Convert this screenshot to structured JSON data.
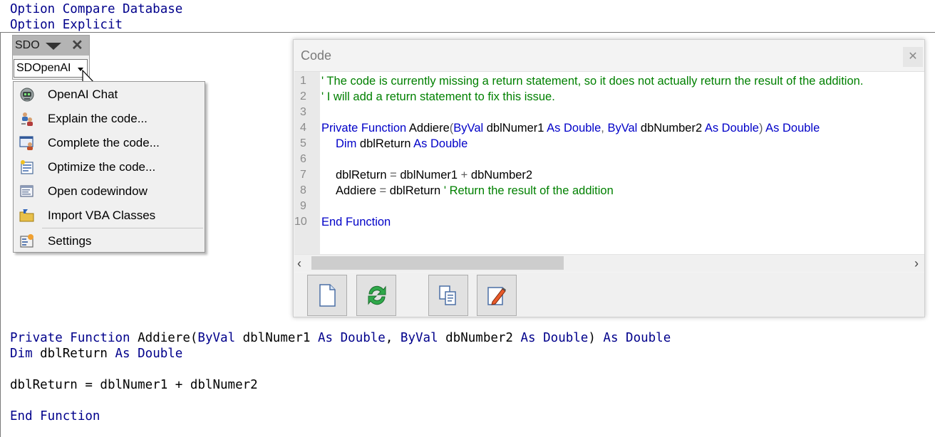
{
  "editor": {
    "header_lines": [
      "Option Compare Database",
      "Option Explicit"
    ],
    "func_keyword_private": "Private Function",
    "func_name": "Addiere(",
    "func_byval1": "ByVal",
    "func_param1": " dblNumer1 ",
    "func_as1": "As Double",
    "func_comma": ", ",
    "func_byval2": "ByVal",
    "func_param2": " dbNumber2 ",
    "func_as2": "As Double",
    "func_close": ") ",
    "func_ret": "As Double",
    "dim_kw": "Dim",
    "dim_var": " dblReturn ",
    "dim_as": "As Double",
    "assign_line": "dblReturn = dblNumer1 + dblNumer2",
    "end_function": "End Function"
  },
  "toolbar": {
    "title": "SDO",
    "close_glyph": "✕",
    "dropdown_label": "SDOpenAI"
  },
  "menu": {
    "items": [
      {
        "label": "OpenAI Chat",
        "icon": "robot-icon"
      },
      {
        "label": "Explain the code...",
        "icon": "users-icon"
      },
      {
        "label": "Complete the code...",
        "icon": "window-user-icon"
      },
      {
        "label": "Optimize the code...",
        "icon": "optimize-icon"
      },
      {
        "label": "Open codewindow",
        "icon": "codewindow-icon"
      },
      {
        "label": "Import VBA Classes",
        "icon": "folder-import-icon"
      },
      {
        "label": "Settings",
        "icon": "settings-icon"
      }
    ]
  },
  "codewin": {
    "title": "Code",
    "close_glyph": "✕",
    "line_numbers": [
      "1",
      "2",
      "3",
      "4",
      "5",
      "6",
      "7",
      "8",
      "9",
      "10"
    ],
    "line1": "' The code is currently missing a return statement, so it does not actually return the result of the addition.",
    "line2": "' I will add a return statement to fix this issue.",
    "l4_private": "Private Function",
    "l4_name": " Addiere",
    "l4_paren": "(",
    "l4_byval1": "ByVal",
    "l4_p1": " dblNumer1 ",
    "l4_as1": "As Double",
    "l4_comma": ", ",
    "l4_byval2": "ByVal",
    "l4_p2": " dbNumber2 ",
    "l4_as2": "As Double",
    "l4_close": ")",
    "l4_ret": " As Double",
    "l5_dim": "Dim",
    "l5_var": " dblReturn ",
    "l5_as": "As Double",
    "l7_a": "dblReturn",
    "l7_eq": " = ",
    "l7_b": "dblNumer1",
    "l7_plus": " + ",
    "l7_c": "dbNumber2",
    "l8_a": "Addiere",
    "l8_eq": " = ",
    "l8_b": "dblReturn ",
    "l8_comment": "' Return the result of the addition",
    "l10": "End Function",
    "scroll_left": "‹",
    "scroll_right": "›",
    "buttons": [
      "new-document-icon",
      "refresh-icon",
      "copy-icon",
      "edit-icon"
    ]
  },
  "colors": {
    "keyword_blue": "#00008b",
    "comment_green": "#008000",
    "code_blue": "#0000c8"
  }
}
